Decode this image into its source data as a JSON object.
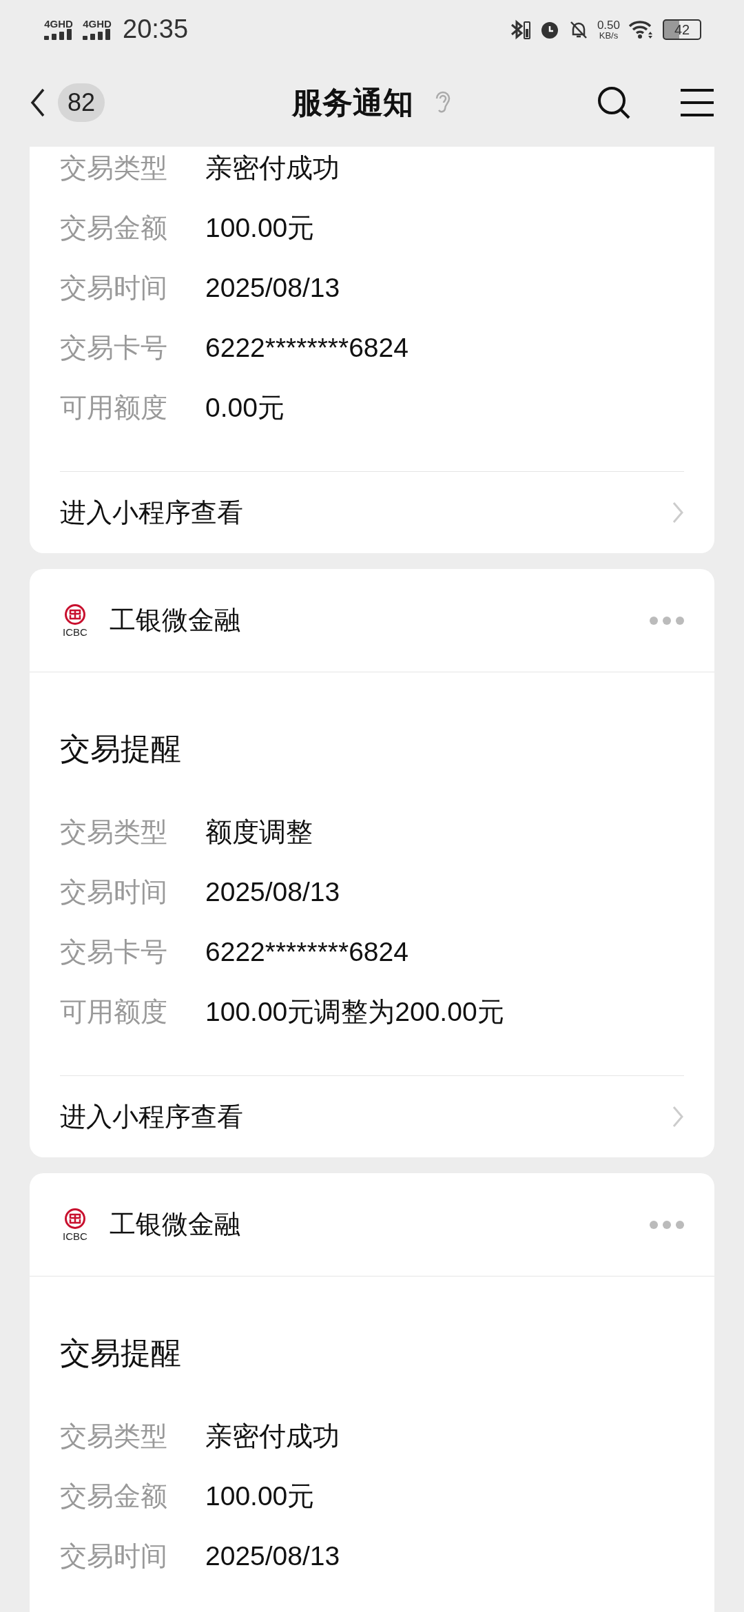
{
  "status_bar": {
    "networks": [
      "4GHD",
      "4GHD"
    ],
    "time": "20:35",
    "speed": "0.50",
    "speed_unit": "KB/s",
    "battery": "42"
  },
  "header": {
    "unread": "82",
    "title": "服务通知"
  },
  "cards": [
    {
      "fields": [
        {
          "label": "交易类型",
          "value": "亲密付成功"
        },
        {
          "label": "交易金额",
          "value": "100.00元"
        },
        {
          "label": "交易时间",
          "value": "2025/08/13"
        },
        {
          "label": "交易卡号",
          "value": "6222********6824"
        },
        {
          "label": "可用额度",
          "value": "0.00元"
        }
      ],
      "link": "进入小程序查看"
    },
    {
      "logo_text": "ICBC",
      "account": "工银微金融",
      "heading": "交易提醒",
      "fields": [
        {
          "label": "交易类型",
          "value": "额度调整"
        },
        {
          "label": "交易时间",
          "value": "2025/08/13"
        },
        {
          "label": "交易卡号",
          "value": "6222********6824"
        },
        {
          "label": "可用额度",
          "value": "100.00元调整为200.00元"
        }
      ],
      "link": "进入小程序查看"
    },
    {
      "logo_text": "ICBC",
      "account": "工银微金融",
      "heading": "交易提醒",
      "fields": [
        {
          "label": "交易类型",
          "value": "亲密付成功"
        },
        {
          "label": "交易金额",
          "value": "100.00元"
        },
        {
          "label": "交易时间",
          "value": "2025/08/13"
        }
      ]
    }
  ]
}
